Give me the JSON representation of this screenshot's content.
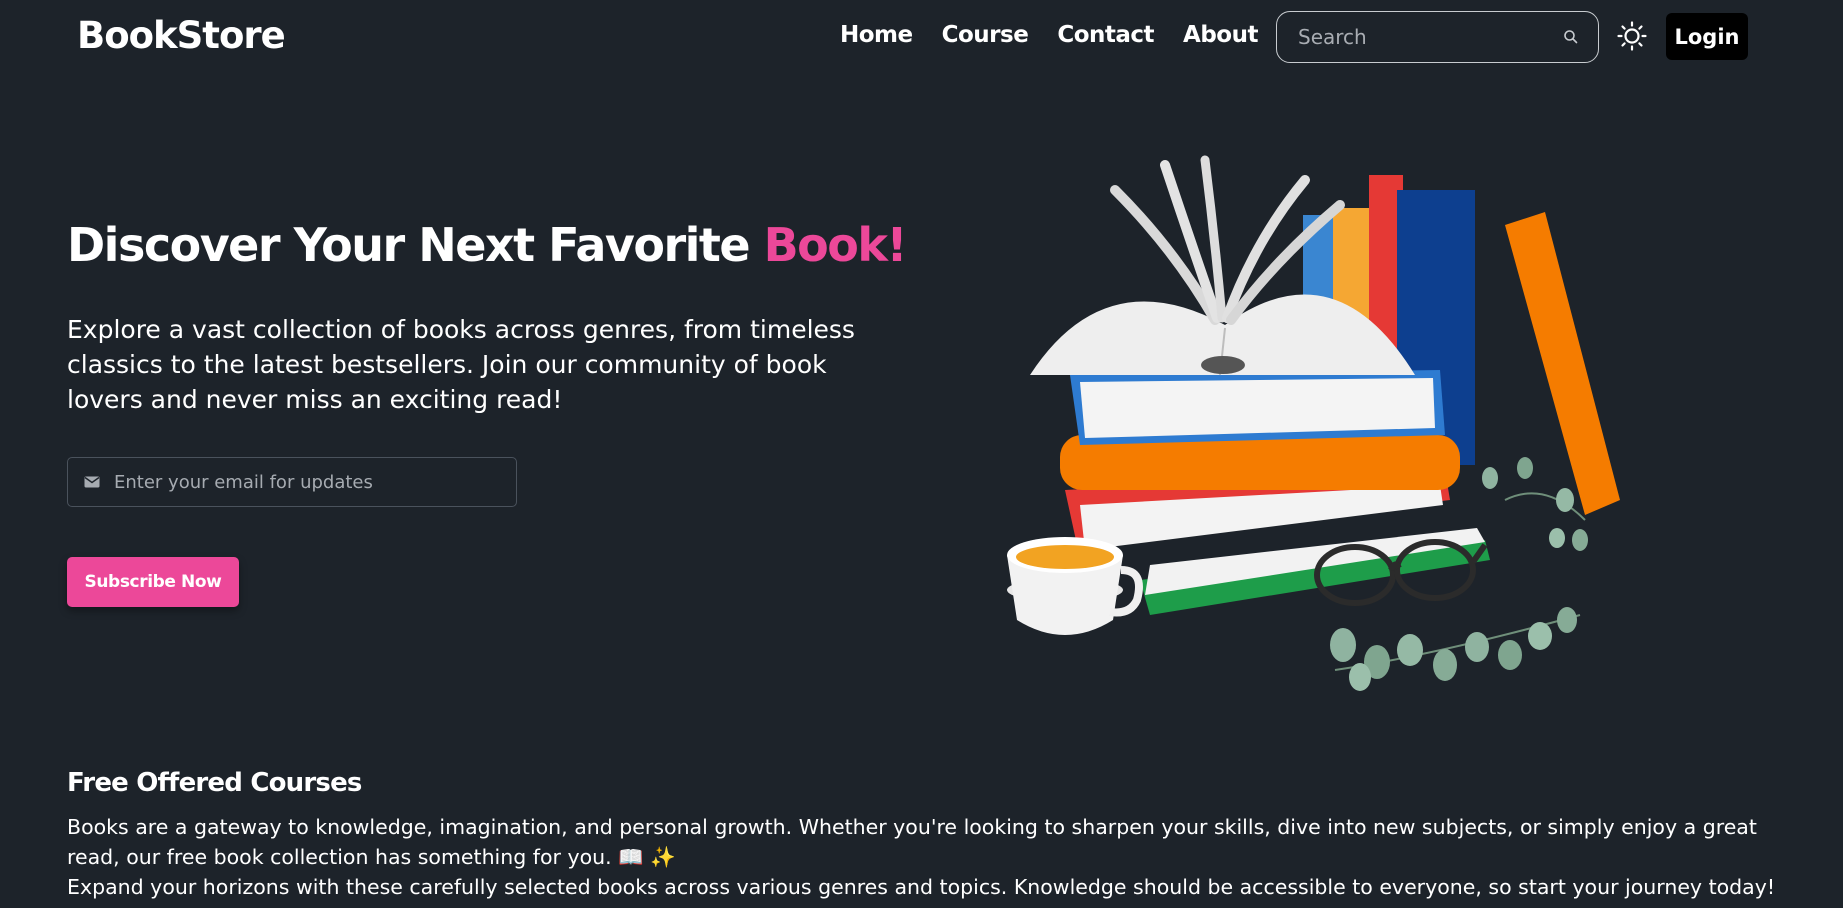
{
  "navbar": {
    "brand": "BookStore",
    "links": [
      {
        "label": "Home"
      },
      {
        "label": "Course"
      },
      {
        "label": "Contact"
      },
      {
        "label": "About"
      }
    ],
    "search": {
      "placeholder": "Search",
      "value": ""
    },
    "theme_icon": "sun-icon",
    "login_label": "Login"
  },
  "hero": {
    "title_main": "Discover Your Next Favorite ",
    "title_accent": "Book!",
    "description": "Explore a vast collection of books across genres, from timeless classics to the latest bestsellers. Join our community of book lovers and never miss an exciting read!",
    "email": {
      "placeholder": "Enter your email for updates",
      "value": ""
    },
    "subscribe_label": "Subscribe Now",
    "illustration": "stack-of-books-with-coffee-cup-and-glasses"
  },
  "courses": {
    "title": "Free Offered Courses",
    "paragraph_1": "Books are a gateway to knowledge, imagination, and personal growth. Whether you're looking to sharpen your skills, dive into new subjects, or simply enjoy a great read, our free book collection has something for you. 📖 ✨",
    "paragraph_2": "Expand your horizons with these carefully selected books across various genres and topics. Knowledge should be accessible to everyone, so start your journey today!"
  },
  "colors": {
    "background": "#1d232a",
    "accent": "#ec4899",
    "login_bg": "#000000"
  }
}
